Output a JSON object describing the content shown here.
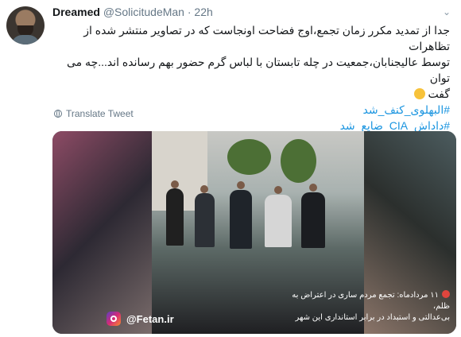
{
  "tweet": {
    "author_name": "Dreamed",
    "author_handle": "@SolicitudeMan",
    "separator": "·",
    "time": "22h",
    "text_line_1": "جدا از تمدید مکرر زمان تجمع،اوج فضاحت اونجاست که در تصاویر منتشر شده از تظاهرات",
    "text_line_2": "توسط عالیجنابان،جمعیت در چله تابستان با لباس گرم حضور بهم رسانده اند...چه می توان",
    "text_line_3": "گفت",
    "hashtags": [
      "#البهلوی_کنف_شد",
      "#داداش_CIA_ضایع_شد"
    ],
    "translate_label": "Translate Tweet"
  },
  "media": {
    "caption_line_1": "۱۱ مردادماه: تجمع مردم ساری در اعتراض به ظلم،",
    "caption_line_2": "بی‌عدالتی و استبداد در برابر استانداری این شهر",
    "watermark": "@Fetan.ir"
  },
  "icons": {
    "chevron": "chevron-down-icon",
    "translate": "globe-icon",
    "instagram": "instagram-icon"
  },
  "colors": {
    "hashtag": "#1b95e0",
    "secondary": "#657786",
    "record_dot": "#e0453d"
  }
}
